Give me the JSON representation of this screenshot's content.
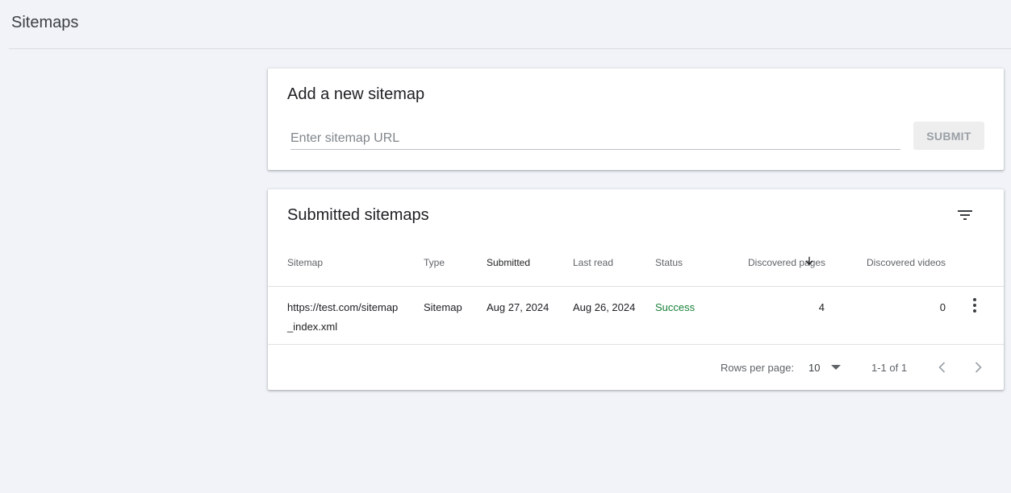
{
  "page": {
    "title": "Sitemaps"
  },
  "add_sitemap": {
    "title": "Add a new sitemap",
    "input_placeholder": "Enter sitemap URL",
    "input_value": "",
    "submit_label": "SUBMIT"
  },
  "submitted": {
    "title": "Submitted sitemaps",
    "columns": {
      "sitemap": "Sitemap",
      "type": "Type",
      "submitted": "Submitted",
      "last_read": "Last read",
      "status": "Status",
      "discovered_pages": "Discovered pages",
      "discovered_videos": "Discovered videos"
    },
    "rows": [
      {
        "sitemap": "https://test.com/sitemap_index.xml",
        "type": "Sitemap",
        "submitted": "Aug 27, 2024",
        "last_read": "Aug 26, 2024",
        "status": "Success",
        "discovered_pages": "4",
        "discovered_videos": "0"
      }
    ],
    "footer": {
      "rows_per_page_label": "Rows per page:",
      "rows_per_page_value": "10",
      "range": "1-1 of 1"
    }
  },
  "colors": {
    "background": "#f1f3f8",
    "success": "#188038",
    "muted": "#5f6368"
  },
  "icons": {
    "filter": "filter-list-icon",
    "sort": "arrow-down-icon",
    "more": "more-vert-icon",
    "dropdown": "arrow-drop-down-icon",
    "prev": "chevron-left-icon",
    "next": "chevron-right-icon"
  }
}
